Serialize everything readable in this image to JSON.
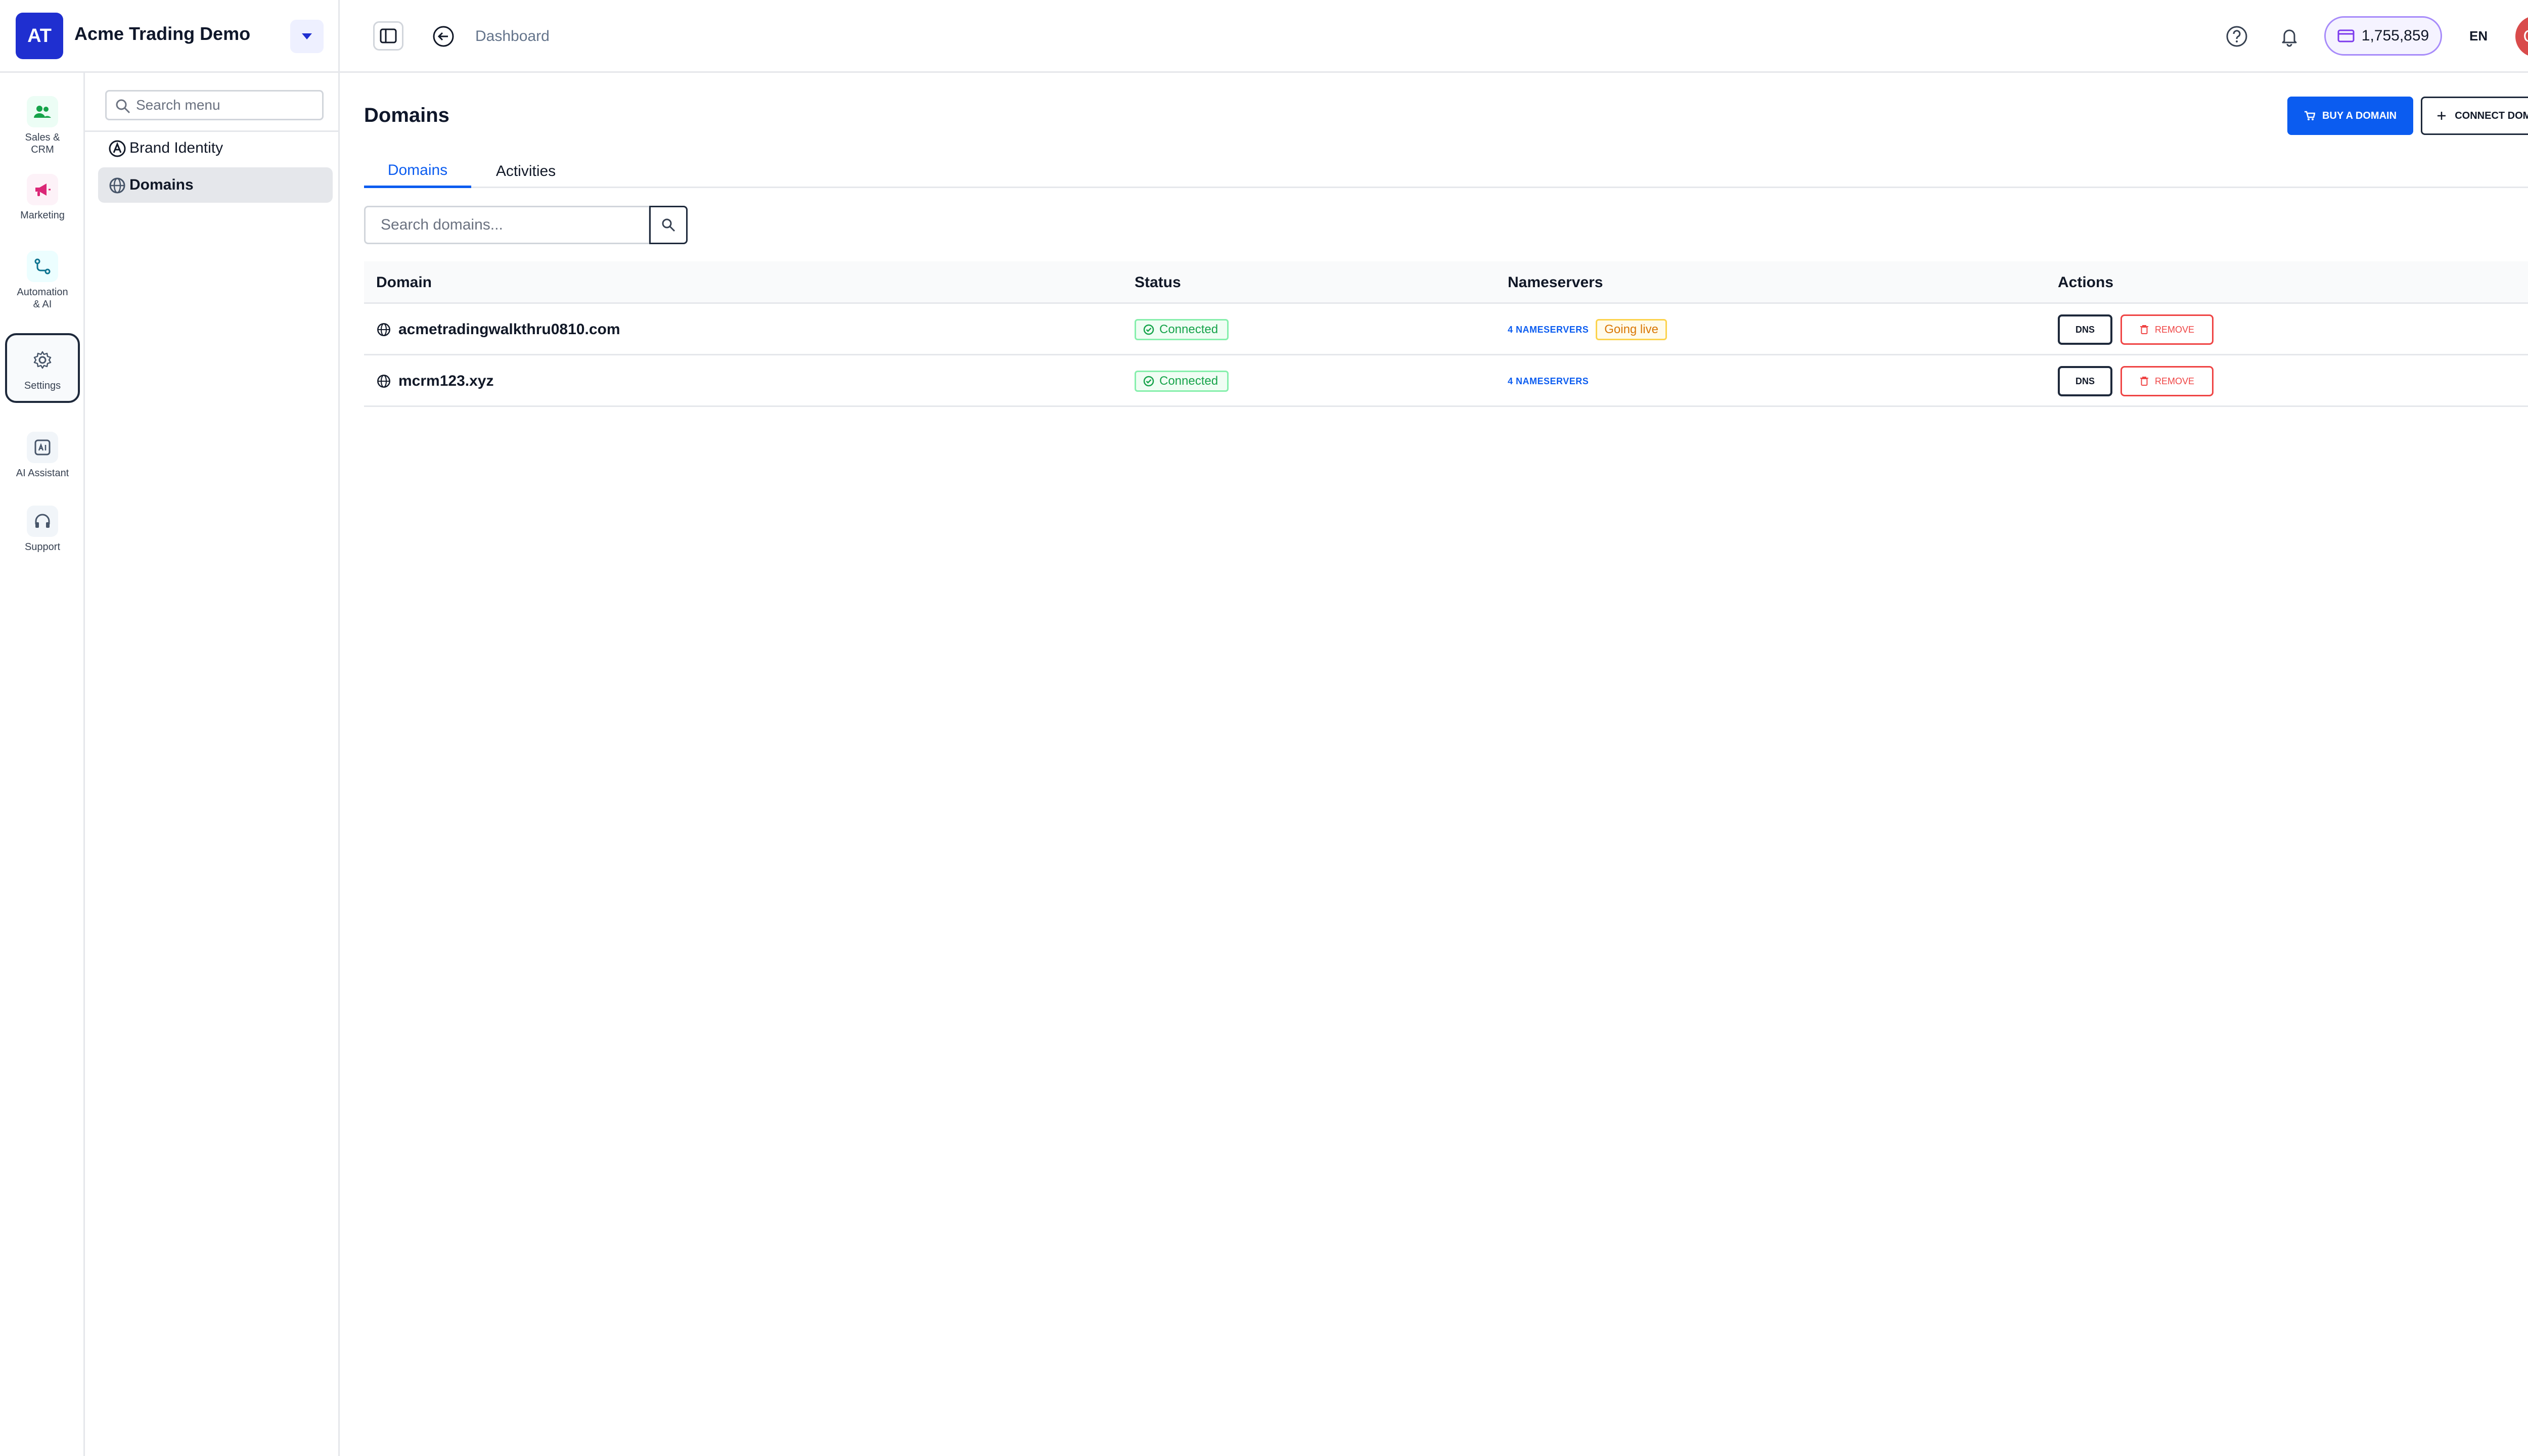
{
  "org": {
    "initials": "AT",
    "name": "Acme Trading Demo"
  },
  "topbar": {
    "breadcrumb": "Dashboard",
    "credits": "1,755,859",
    "language": "EN",
    "user_initials": "OD"
  },
  "rail": {
    "items": [
      {
        "label": "Sales &\nCRM",
        "icon": "users-icon"
      },
      {
        "label": "Marketing",
        "icon": "megaphone-icon"
      },
      {
        "label": "Automation\n& AI",
        "icon": "workflow-icon"
      },
      {
        "label": "Settings",
        "icon": "gear-icon"
      },
      {
        "label": "AI Assistant",
        "icon": "ai-assistant-icon"
      },
      {
        "label": "Support",
        "icon": "headphones-icon"
      }
    ]
  },
  "menu": {
    "search_placeholder": "Search menu",
    "items": [
      {
        "label": "Brand Identity",
        "icon": "brand-icon"
      },
      {
        "label": "Domains",
        "icon": "globe-icon"
      }
    ]
  },
  "page": {
    "title": "Domains",
    "buy_label": "BUY A DOMAIN",
    "connect_label": "CONNECT DOMAIN",
    "tabs": [
      {
        "label": "Domains",
        "active": true
      },
      {
        "label": "Activities",
        "active": false
      }
    ],
    "search_placeholder": "Search domains..."
  },
  "table": {
    "columns": [
      "Domain",
      "Status",
      "Nameservers",
      "Actions"
    ],
    "rows": [
      {
        "domain": "acmetradingwalkthru0810.com",
        "status": "Connected",
        "nameservers": "4 NAMESERVERS",
        "badge": "Going live",
        "dns_label": "DNS",
        "remove_label": "REMOVE"
      },
      {
        "domain": "mcrm123.xyz",
        "status": "Connected",
        "nameservers": "4 NAMESERVERS",
        "badge": "",
        "dns_label": "DNS",
        "remove_label": "REMOVE"
      }
    ]
  },
  "colors": {
    "brand": "#1f2fd0",
    "primary": "#0b5cf0",
    "success": "#16a34a",
    "warning": "#d97706",
    "danger": "#ef4444",
    "avatar": "#d94b4b"
  }
}
